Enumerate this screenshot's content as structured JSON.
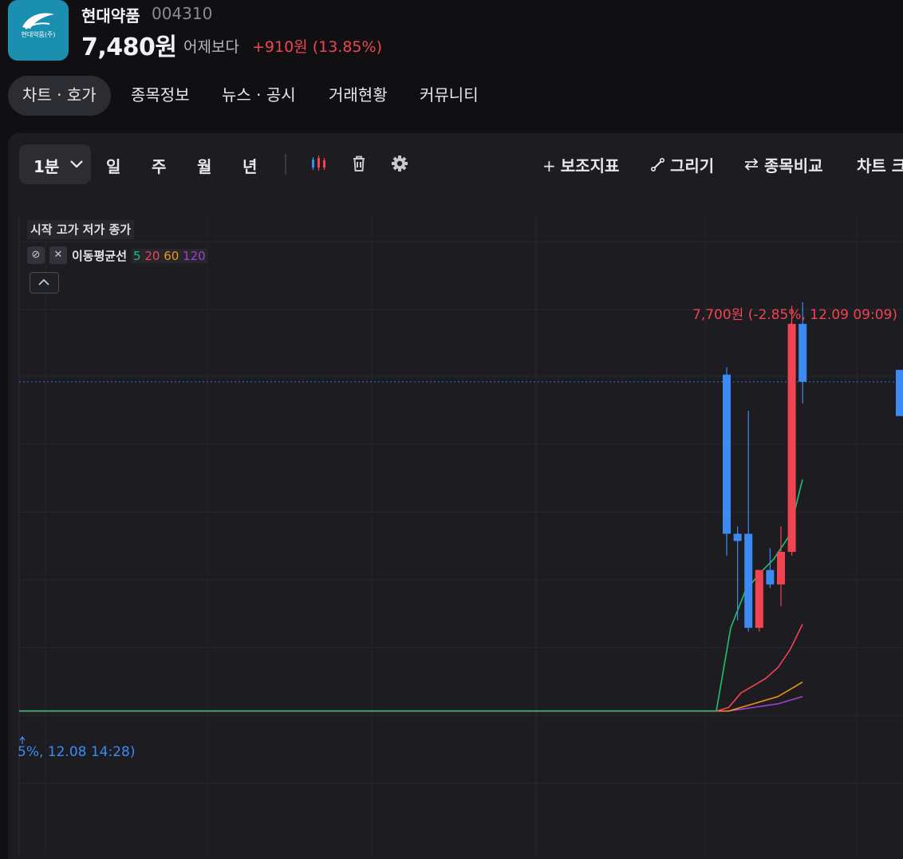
{
  "stock": {
    "name": "현대약품",
    "code": "004310",
    "price": "7,480원",
    "compare_label": "어제보다",
    "change": "+910원 (13.85%)",
    "logo_text": "현대약품(주)"
  },
  "tabs": [
    {
      "label": "차트 · 호가",
      "active": true
    },
    {
      "label": "종목정보",
      "active": false
    },
    {
      "label": "뉴스 · 공시",
      "active": false
    },
    {
      "label": "거래현황",
      "active": false
    },
    {
      "label": "커뮤니티",
      "active": false
    }
  ],
  "toolbar": {
    "timeframe_selected": "1분",
    "timeframes": [
      "일",
      "주",
      "월",
      "년"
    ],
    "icons": [
      "candle-type-icon",
      "trash-icon",
      "settings-icon"
    ],
    "indicator": {
      "symbol": "+",
      "label": "보조지표"
    },
    "draw": {
      "label": "그리기"
    },
    "compare": {
      "label": "종목비교"
    },
    "chart_cut": {
      "label": "차트 크"
    }
  },
  "legend": {
    "ohlc_label": "시작 고가 저가 종가",
    "ma_label": "이동평균선",
    "ma_periods": [
      "5",
      "20",
      "60",
      "120"
    ]
  },
  "annotations": {
    "high": "7,700원 (-2.85%, 12.09 09:09)",
    "low": "5%, 12.08 14:28)"
  },
  "colors": {
    "up": "#f04452",
    "down": "#3d8bf2",
    "ma5": "#20c070",
    "ma20": "#f04452",
    "ma60": "#f0941a",
    "ma120": "#a040d0",
    "background": "#1c1c21"
  },
  "chart_data": {
    "type": "candlestick",
    "interval": "1분",
    "candles": [
      {
        "open": 7500,
        "high": 7520,
        "low": 7000,
        "close": 7060
      },
      {
        "open": 7060,
        "high": 7080,
        "low": 6820,
        "close": 7040
      },
      {
        "open": 7060,
        "high": 7400,
        "low": 6790,
        "close": 6800
      },
      {
        "open": 6800,
        "high": 6950,
        "low": 6790,
        "close": 6960
      },
      {
        "open": 6960,
        "high": 7020,
        "low": 6910,
        "close": 6920
      },
      {
        "open": 6920,
        "high": 7080,
        "low": 6860,
        "close": 7010
      },
      {
        "open": 7010,
        "high": 7690,
        "low": 7000,
        "close": 7640
      },
      {
        "open": 7640,
        "high": 7700,
        "low": 7420,
        "close": 7480
      }
    ],
    "moving_averages": [
      {
        "period": "5",
        "values": [
          6570,
          6570,
          6570,
          6570,
          6570,
          6570,
          6570,
          6570,
          6800,
          6900,
          6950,
          6990,
          7050,
          7210
        ]
      },
      {
        "period": "20",
        "values": [
          6570,
          6570,
          6570,
          6570,
          6570,
          6570,
          6570,
          6570,
          6580,
          6620,
          6640,
          6660,
          6690,
          6740,
          6810
        ]
      },
      {
        "period": "60",
        "values": [
          6570,
          6570,
          6570,
          6570,
          6570,
          6570,
          6570,
          6570,
          6570,
          6580,
          6590,
          6600,
          6610,
          6630,
          6650
        ]
      },
      {
        "period": "120",
        "values": [
          6570,
          6570,
          6570,
          6570,
          6570,
          6570,
          6570,
          6570,
          6570,
          6575,
          6580,
          6585,
          6590,
          6600,
          6610
        ]
      }
    ],
    "current_price": 7480,
    "ylim": [
      6170,
      7940
    ],
    "grid": true
  }
}
